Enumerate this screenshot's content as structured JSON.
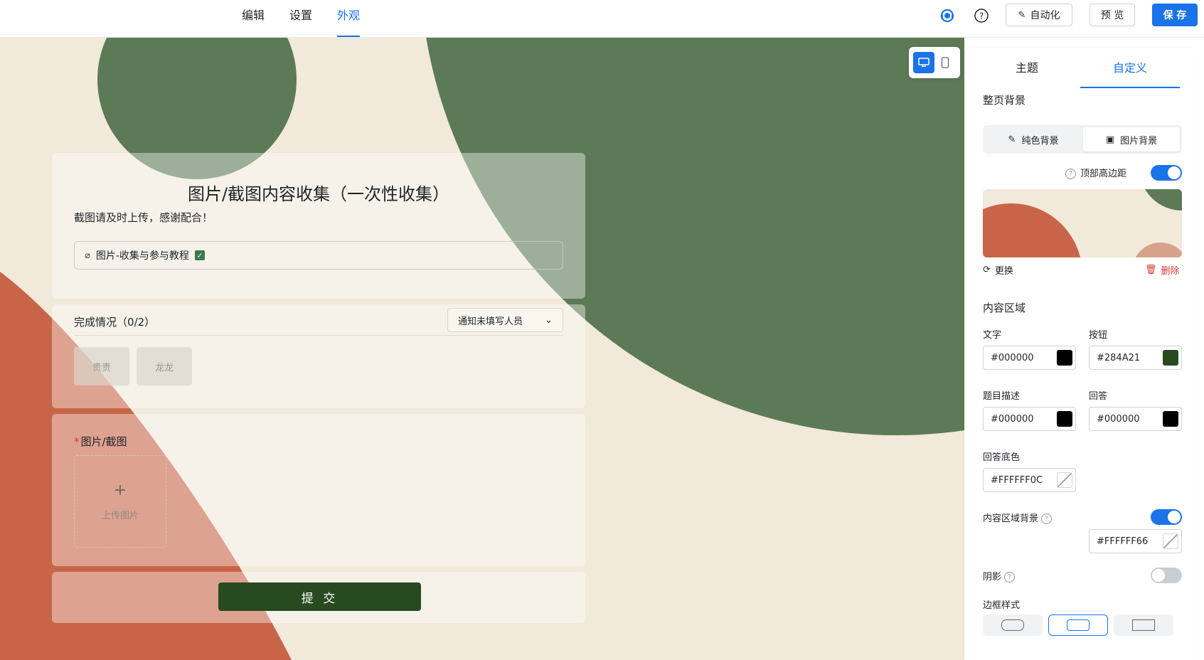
{
  "topbar": {
    "tabs": [
      {
        "label": "编辑",
        "active": false
      },
      {
        "label": "设置",
        "active": false
      },
      {
        "label": "外观",
        "active": true
      }
    ],
    "icons": [
      "support-icon",
      "help-icon"
    ],
    "automation_label": "自动化",
    "preview_label": "预 览",
    "save_label": "保 存"
  },
  "form": {
    "title": "图片/截图内容收集（一次性收集）",
    "description": "截图请及时上传，感谢配合！",
    "attachment": "图片-收集与参与教程",
    "status": {
      "title": "完成情况（0/2）",
      "notify_label": "通知未填写人员",
      "people": [
        "贵贵",
        "龙龙"
      ]
    },
    "question": {
      "required_mark": "*",
      "title": "图片/截图",
      "upload_label": "上传图片"
    },
    "submit_label": "提 交"
  },
  "device_toggle": {
    "options": [
      "desktop",
      "mobile"
    ],
    "active": "desktop"
  },
  "panel": {
    "tabs": [
      {
        "label": "主题",
        "active": false
      },
      {
        "label": "自定义",
        "active": true
      }
    ],
    "page_bg": {
      "title": "整页背景",
      "solid_label": "纯色背景",
      "image_label": "图片背景",
      "active": "image",
      "top_margin_label": "顶部高边距",
      "top_margin_on": true,
      "replace_label": "更换",
      "delete_label": "删除"
    },
    "content": {
      "title": "内容区域",
      "text_label": "文字",
      "text_color": "#000000",
      "button_label": "按钮",
      "button_color": "#284A21",
      "desc_label": "题目描述",
      "desc_color": "#000000",
      "answer_label": "回答",
      "answer_color": "#000000",
      "answer_bg_label": "回答底色",
      "answer_bg_color": "#FFFFFF0C",
      "content_bg_label": "内容区域背景",
      "content_bg_on": true,
      "content_bg_color": "#FFFFFF66",
      "shadow_label": "阴影",
      "shadow_on": false,
      "border_style_label": "边框样式",
      "border_styles": [
        "rounded",
        "rounded-small",
        "square"
      ],
      "border_style_active": "rounded-small"
    }
  },
  "colors": {
    "accent": "#1a73e8",
    "green": "#5d7a56",
    "terracotta": "#c86549",
    "cream": "#f1e9da",
    "button": "#284a21"
  }
}
